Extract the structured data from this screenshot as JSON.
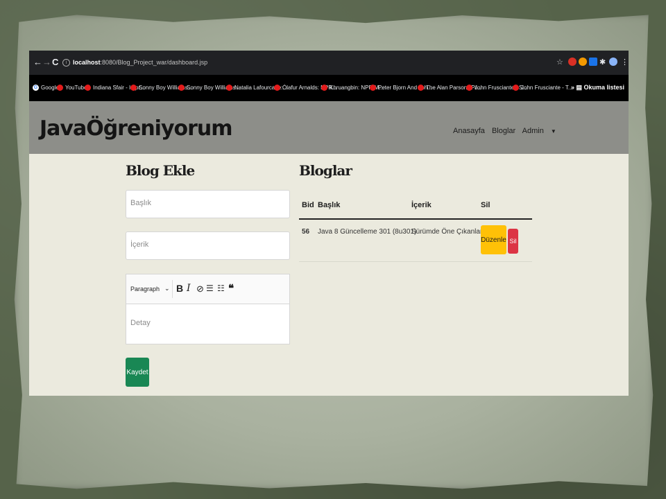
{
  "browser": {
    "url_host": "localhost",
    "url_path": ":8080/Blog_Project_war/dashboard.jsp",
    "bookmarks": [
      {
        "label": "Google",
        "icon": "google-icon"
      },
      {
        "label": "YouTube",
        "icon": "youtube-icon"
      },
      {
        "label": "Indiana Sfair - Impr...",
        "icon": "youtube-icon"
      },
      {
        "label": "Sonny Boy Williams...",
        "icon": "youtube-icon"
      },
      {
        "label": "Sonny Boy Williams...",
        "icon": "youtube-icon"
      },
      {
        "label": "Natalia Lafourcade:...",
        "icon": "youtube-icon"
      },
      {
        "label": "Ólafur Arnalds: NPR...",
        "icon": "youtube-icon"
      },
      {
        "label": "Khruangbin: NPR M...",
        "icon": "youtube-icon"
      },
      {
        "label": "Peter Bjorn And Joh...",
        "icon": "youtube-icon"
      },
      {
        "label": "The Alan Parsons Pr...",
        "icon": "youtube-icon"
      },
      {
        "label": "John Frusciante - S...",
        "icon": "youtube-icon"
      },
      {
        "label": "John Frusciante - T...",
        "icon": "youtube-icon"
      }
    ],
    "reading_list": "Okuma listesi"
  },
  "site": {
    "brand": "JavaÖğreniyorum",
    "nav": {
      "home": "Anasayfa",
      "blogs": "Bloglar",
      "admin": "Admin"
    }
  },
  "form": {
    "title": "Blog Ekle",
    "title_placeholder": "Başlık",
    "content_placeholder": "İçerik",
    "editor": {
      "paragraph": "Paragraph",
      "detail_placeholder": "Detay"
    },
    "save_label": "Kaydet"
  },
  "blogs": {
    "title": "Bloglar",
    "headers": {
      "id": "Bid",
      "title": "Başlık",
      "content": "İçerik",
      "delete": "Sil"
    },
    "rows": [
      {
        "id": "56",
        "title": "Java 8 Güncelleme 301 (8u301)",
        "content": "Sürümde Öne Çıkanlar",
        "edit_label": "Düzenle",
        "delete_label": "Sil"
      }
    ]
  },
  "colors": {
    "save": "#198754",
    "edit": "#ffc107",
    "delete": "#dc3545",
    "navbar": "#8d8e89",
    "page": "#ebeade"
  }
}
